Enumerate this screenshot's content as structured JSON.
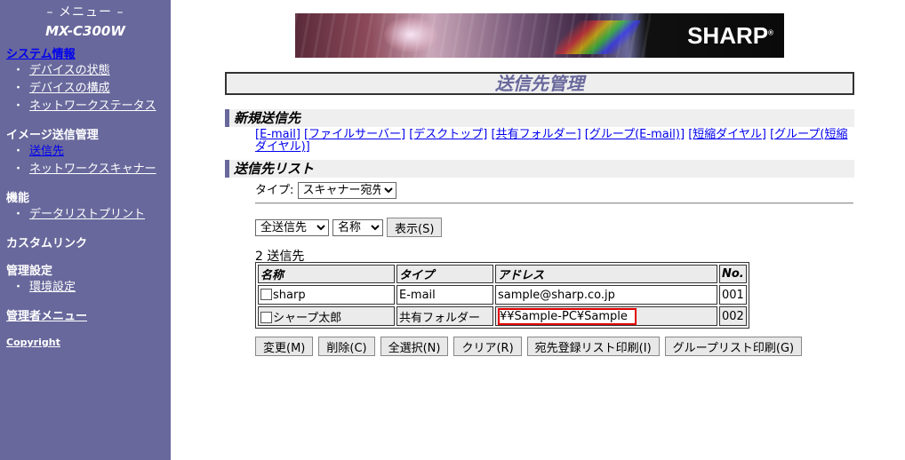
{
  "sidebar": {
    "menu_title": "– メニュー –",
    "model": "MX-C300W",
    "system_info": "システム情報",
    "system_items": [
      "デバイスの状態",
      "デバイスの構成",
      "ネットワークステータス"
    ],
    "image_send_head": "イメージ送信管理",
    "image_send_items": [
      "送信先",
      "ネットワークスキャナー"
    ],
    "function_head": "機能",
    "function_items": [
      "データリストプリント"
    ],
    "custom_link": "カスタムリンク",
    "admin_settings_head": "管理設定",
    "admin_settings_items": [
      "環境設定"
    ],
    "admin_menu": "管理者メニュー",
    "copyright": "Copyright"
  },
  "banner": {
    "brand": "SHARP"
  },
  "page_title": "送信先管理",
  "new_dest": {
    "heading": "新規送信先",
    "links": [
      "[E-mail]",
      "[ファイルサーバー]",
      "[デスクトップ]",
      "[共有フォルダー]",
      "[グループ(E-mail)]",
      "[短縮ダイヤル]",
      "[グループ(短縮ダイヤル)]"
    ]
  },
  "dest_list": {
    "heading": "送信先リスト",
    "type_label": "タイプ:",
    "type_value": "スキャナー宛先",
    "filter_value": "全送信先",
    "sort_value": "名称",
    "show_button": "表示(S)",
    "count_text": "2 送信先",
    "columns": [
      "名称",
      "タイプ",
      "アドレス",
      "No."
    ],
    "rows": [
      {
        "name": "sharp",
        "type": "E-mail",
        "address": "sample@sharp.co.jp",
        "no": "001"
      },
      {
        "name": "シャープ太郎",
        "type": "共有フォルダー",
        "address": "¥¥Sample-PC¥Sample",
        "no": "002"
      }
    ],
    "actions": [
      "変更(M)",
      "削除(C)",
      "全選択(N)",
      "クリア(R)",
      "宛先登録リスト印刷(I)",
      "グループリスト印刷(G)"
    ]
  },
  "colors": {
    "sidebar_bg": "#68689c",
    "title_text": "#68689c",
    "highlight": "#e00000"
  }
}
